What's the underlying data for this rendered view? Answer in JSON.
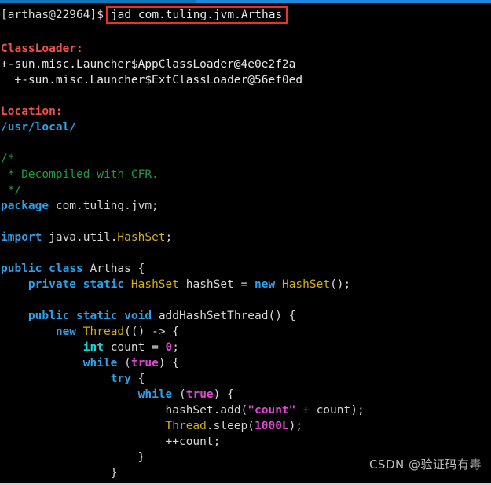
{
  "terminal": {
    "prompt": "[arthas@22964]$",
    "command": "jad com.tuling.jvm.Arthas",
    "accent_red": "#e8332a",
    "background": "#000000",
    "topbar_color_left": "#1177bb",
    "topbar_color_right": "#1c8adb"
  },
  "output": {
    "classloader_header": "ClassLoader:",
    "classloader_lines": [
      "+-sun.misc.Launcher$AppClassLoader@4e0e2f2a",
      "  +-sun.misc.Launcher$ExtClassLoader@56ef0ed"
    ],
    "location_header": "Location:",
    "location_path": "/usr/local/"
  },
  "code": {
    "comment_open": "/*",
    "comment_body": " * Decompiled with CFR.",
    "comment_close": " */",
    "package_keyword": "package",
    "package_name": " com.tuling.jvm;",
    "import_keyword": "import",
    "import_name": " java.util.",
    "import_type": "HashSet",
    "import_semi": ";",
    "class_public": "public",
    "class_keyword": "class",
    "class_name": "Arthas",
    "class_brace": "{",
    "field_private": "private",
    "field_static": "static",
    "field_type": "HashSet",
    "field_name": " hashSet = ",
    "field_new": "new",
    "field_ctor_type": "HashSet",
    "field_ctor_tail": "();",
    "method_public": "public",
    "method_static": "static",
    "method_void": "void",
    "method_name": " addHashSetThread() {",
    "lambda_new": "new",
    "lambda_type": "Thread",
    "lambda_tail": "(() -> {",
    "int_keyword": "int",
    "int_name": " count = ",
    "int_value": "0",
    "int_semi": ";",
    "while1_keyword": "while",
    "while1_open": " (",
    "while1_cond": "true",
    "while1_close": ") {",
    "try_keyword": "try",
    "try_brace": " {",
    "while2_keyword": "while",
    "while2_open": " (",
    "while2_cond": "true",
    "while2_close": ") {",
    "add_prefix": "hashSet.add(",
    "add_string": "\"count\"",
    "add_suffix": " + count);",
    "sleep_type": "Thread",
    "sleep_mid": ".sleep(",
    "sleep_value": "1000L",
    "sleep_tail": ");",
    "increment": "++count;",
    "close_inner": "}",
    "close_outer": "}"
  },
  "watermark": {
    "text": "CSDN @验证码有毒"
  }
}
